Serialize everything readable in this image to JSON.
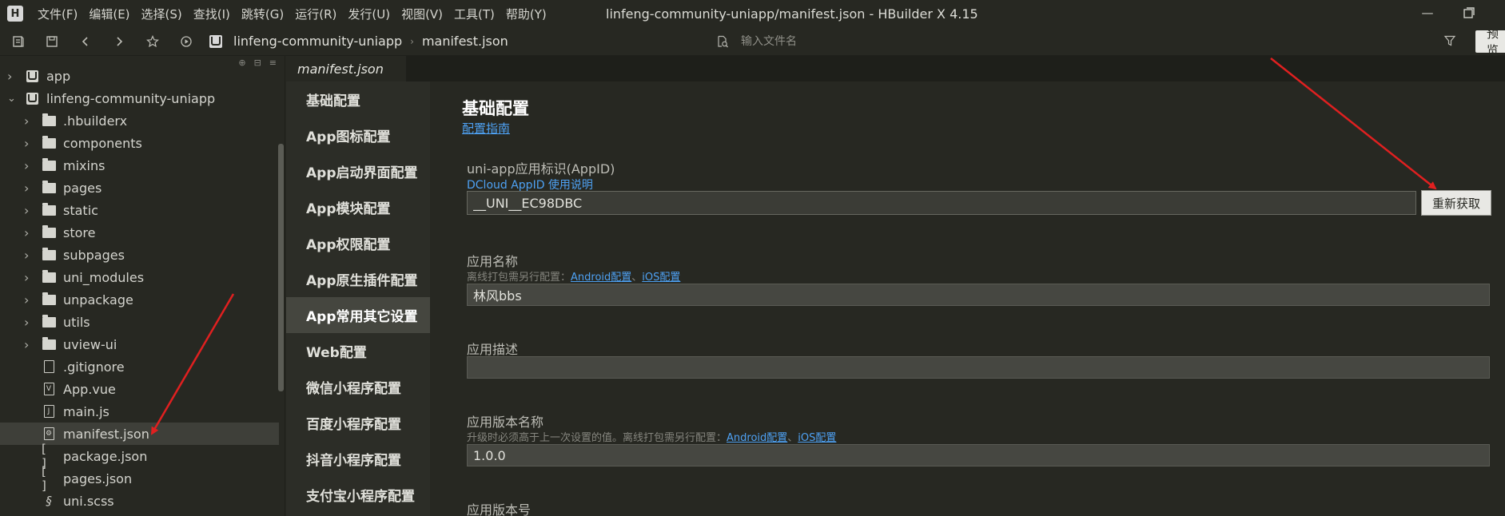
{
  "titlebar": {
    "menu": [
      "文件(F)",
      "编辑(E)",
      "选择(S)",
      "查找(I)",
      "跳转(G)",
      "运行(R)",
      "发行(U)",
      "视图(V)",
      "工具(T)",
      "帮助(Y)"
    ],
    "window_title": "linfeng-community-uniapp/manifest.json - HBuilder X 4.15"
  },
  "toolbar": {
    "breadcrumb": [
      "linfeng-community-uniapp",
      "manifest.json"
    ],
    "file_search_placeholder": "输入文件名",
    "preview_label": "预览"
  },
  "sidebar": {
    "items": [
      {
        "label": "app",
        "kind": "project",
        "expanded": false,
        "depth": 0
      },
      {
        "label": "linfeng-community-uniapp",
        "kind": "project",
        "expanded": true,
        "depth": 0
      },
      {
        "label": ".hbuilderx",
        "kind": "folder",
        "depth": 1
      },
      {
        "label": "components",
        "kind": "folder",
        "depth": 1
      },
      {
        "label": "mixins",
        "kind": "folder",
        "depth": 1
      },
      {
        "label": "pages",
        "kind": "folder",
        "depth": 1
      },
      {
        "label": "static",
        "kind": "folder",
        "depth": 1
      },
      {
        "label": "store",
        "kind": "folder",
        "depth": 1
      },
      {
        "label": "subpages",
        "kind": "folder",
        "depth": 1
      },
      {
        "label": "uni_modules",
        "kind": "folder",
        "depth": 1
      },
      {
        "label": "unpackage",
        "kind": "folder",
        "depth": 1
      },
      {
        "label": "utils",
        "kind": "folder",
        "depth": 1
      },
      {
        "label": "uview-ui",
        "kind": "folder",
        "depth": 1
      },
      {
        "label": ".gitignore",
        "kind": "file",
        "depth": 1
      },
      {
        "label": "App.vue",
        "kind": "vue",
        "depth": 1
      },
      {
        "label": "main.js",
        "kind": "js",
        "depth": 1
      },
      {
        "label": "manifest.json",
        "kind": "manifest",
        "depth": 1,
        "selected": true
      },
      {
        "label": "package.json",
        "kind": "json",
        "depth": 1
      },
      {
        "label": "pages.json",
        "kind": "json",
        "depth": 1
      },
      {
        "label": "uni.scss",
        "kind": "scss",
        "depth": 1
      }
    ]
  },
  "editor": {
    "tab": "manifest.json"
  },
  "settings_nav": {
    "items": [
      "基础配置",
      "App图标配置",
      "App启动界面配置",
      "App模块配置",
      "App权限配置",
      "App原生插件配置",
      "App常用其它设置",
      "Web配置",
      "微信小程序配置",
      "百度小程序配置",
      "抖音小程序配置",
      "支付宝小程序配置"
    ],
    "active_index": 6
  },
  "config": {
    "title": "基础配置",
    "guide_link": "配置指南",
    "appid": {
      "label": "uni-app应用标识(AppID)",
      "link": "DCloud AppID 使用说明",
      "value": "__UNI__EC98DBC",
      "button": "重新获取"
    },
    "app_name": {
      "label": "应用名称",
      "hint": "离线打包需另行配置：",
      "link_android": "Android配置",
      "sep": "、",
      "link_ios": "iOS配置",
      "value": "林风bbs"
    },
    "app_desc": {
      "label": "应用描述",
      "value": ""
    },
    "version_name": {
      "label": "应用版本名称",
      "hint": "升级时必须高于上一次设置的值。离线打包需另行配置：",
      "link_android": "Android配置",
      "sep": "、",
      "link_ios": "iOS配置",
      "value": "1.0.0"
    },
    "version_code": {
      "label": "应用版本号"
    }
  }
}
